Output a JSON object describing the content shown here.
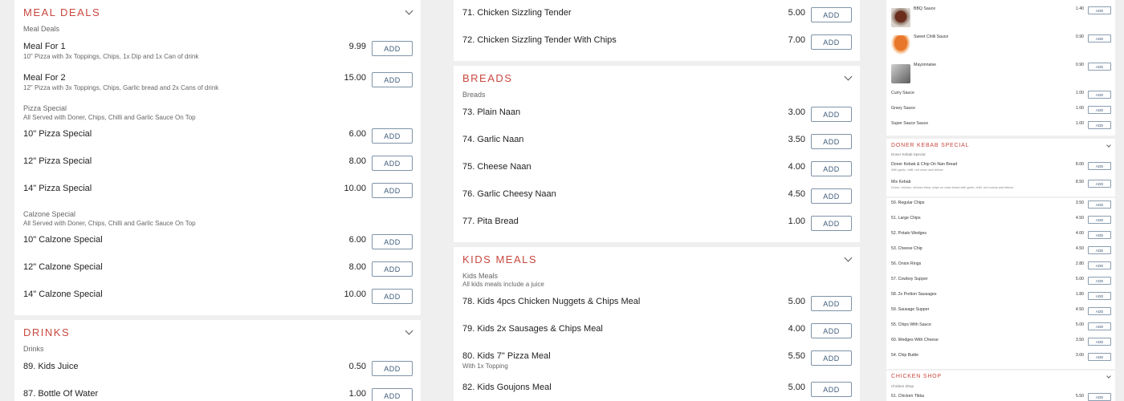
{
  "colors": {
    "accent": "#c8483f",
    "button_border": "#7f93a8",
    "background": "#efefef"
  },
  "add_label": "ADD",
  "col1": {
    "meal_deals": {
      "title": "MEAL DEALS",
      "subtitle": "Meal Deals",
      "items": [
        {
          "name": "Meal For 1",
          "desc": "10\" Pizza with 3x Toppings, Chips, 1x Dip and 1x Can of drink",
          "price": "9.99"
        },
        {
          "name": "Meal For 2",
          "desc": "12\" Pizza with 3x Toppings, Chips, Garlic bread and 2x Cans of drink",
          "price": "15.00"
        }
      ],
      "pizza_group": {
        "title": "Pizza Special",
        "desc": "All Served with Doner, Chips, Chilli and Garlic Sauce On Top"
      },
      "pizza_items": [
        {
          "name": "10\" Pizza Special",
          "price": "6.00"
        },
        {
          "name": "12\" Pizza Special",
          "price": "8.00"
        },
        {
          "name": "14\" Pizza Special",
          "price": "10.00"
        }
      ],
      "calzone_group": {
        "title": "Calzone Special",
        "desc": "All Served with Doner, Chips, Chilli and Garlic Sauce On Top"
      },
      "calzone_items": [
        {
          "name": "10\" Calzone Special",
          "price": "6.00"
        },
        {
          "name": "12\" Calzone Special",
          "price": "8.00"
        },
        {
          "name": "14\" Calzone Special",
          "price": "10.00"
        }
      ]
    },
    "drinks": {
      "title": "DRINKS",
      "subtitle": "Drinks",
      "items": [
        {
          "name": "89. Kids Juice",
          "price": "0.50"
        },
        {
          "name": "87. Bottle Of Water",
          "price": "1.00"
        }
      ]
    }
  },
  "col2": {
    "chicken_items": [
      {
        "name": "71. Chicken Sizzling Tender",
        "price": "5.00"
      },
      {
        "name": "72. Chicken Sizzling Tender With Chips",
        "price": "7.00"
      }
    ],
    "breads": {
      "title": "BREADS",
      "subtitle": "Breads",
      "items": [
        {
          "name": "73. Plain Naan",
          "price": "3.00"
        },
        {
          "name": "74. Garlic Naan",
          "price": "3.50"
        },
        {
          "name": "75. Cheese Naan",
          "price": "4.00"
        },
        {
          "name": "76. Garlic Cheesy Naan",
          "price": "4.50"
        },
        {
          "name": "77. Pita Bread",
          "price": "1.00"
        }
      ]
    },
    "kids": {
      "title": "KIDS MEALS",
      "subtitle": "Kids Meals",
      "subdesc": "All kids meals include a juice",
      "items": [
        {
          "name": "78. Kids 4pcs Chicken Nuggets & Chips Meal",
          "desc": "",
          "price": "5.00"
        },
        {
          "name": "79. Kids 2x Sausages & Chips Meal",
          "desc": "",
          "price": "4.00"
        },
        {
          "name": "80. Kids 7\" Pizza Meal",
          "desc": "With 1x Topping",
          "price": "5.50"
        },
        {
          "name": "82. Kids Goujons Meal",
          "desc": "",
          "price": "5.00"
        }
      ]
    }
  },
  "col3": {
    "sauces": [
      {
        "name": "BBQ Sauce",
        "price": "1.40"
      },
      {
        "name": "Sweet Chilli Sauce",
        "price": "0.90"
      },
      {
        "name": "Mayonnaise",
        "price": "0.90"
      },
      {
        "name": "Curry Sauce",
        "price": "1.00"
      },
      {
        "name": "Gravy Sauce",
        "price": "1.00"
      },
      {
        "name": "Super Sauce Sauce",
        "price": "1.00"
      }
    ],
    "doner": {
      "title": "DONER KEBAB SPECIAL",
      "subtitle": "Doner Kebab Special",
      "items": [
        {
          "name": "Doner Kebab & Chip On Nan Bread",
          "desc": "With garlic, chilli, red onion and lettuce",
          "price": "8.00"
        },
        {
          "name": "Mix Kebab",
          "desc": "Doner, chicken, chicken tikka, chips on naan bread with garlic, chilli, red onions and lettuce",
          "price": "8.50"
        }
      ]
    },
    "sides": [
      {
        "name": "50. Regular Chips",
        "price": "3.50"
      },
      {
        "name": "51. Large Chips",
        "price": "4.50"
      },
      {
        "name": "52. Potato Wedges",
        "price": "4.00"
      },
      {
        "name": "53. Cheese Chip",
        "price": "4.50"
      },
      {
        "name": "56. Onion Rings",
        "price": "2.80"
      },
      {
        "name": "57. Cowboy Supper",
        "price": "5.00"
      },
      {
        "name": "58. 2x Portion Sausages",
        "price": "1.80"
      },
      {
        "name": "59. Sausage Supper",
        "price": "4.50"
      },
      {
        "name": "55. Chips With Sauce",
        "price": "5.00"
      },
      {
        "name": "60. Wedges With Cheese",
        "price": "3.50"
      },
      {
        "name": "54. Chip Buttie",
        "price": "3.00"
      }
    ],
    "chicken_shop": {
      "title": "CHICKEN SHOP",
      "subtitle": "Chicken Shop",
      "items": [
        {
          "name": "61. Chicken Tikka",
          "price": "5.50"
        }
      ]
    }
  }
}
